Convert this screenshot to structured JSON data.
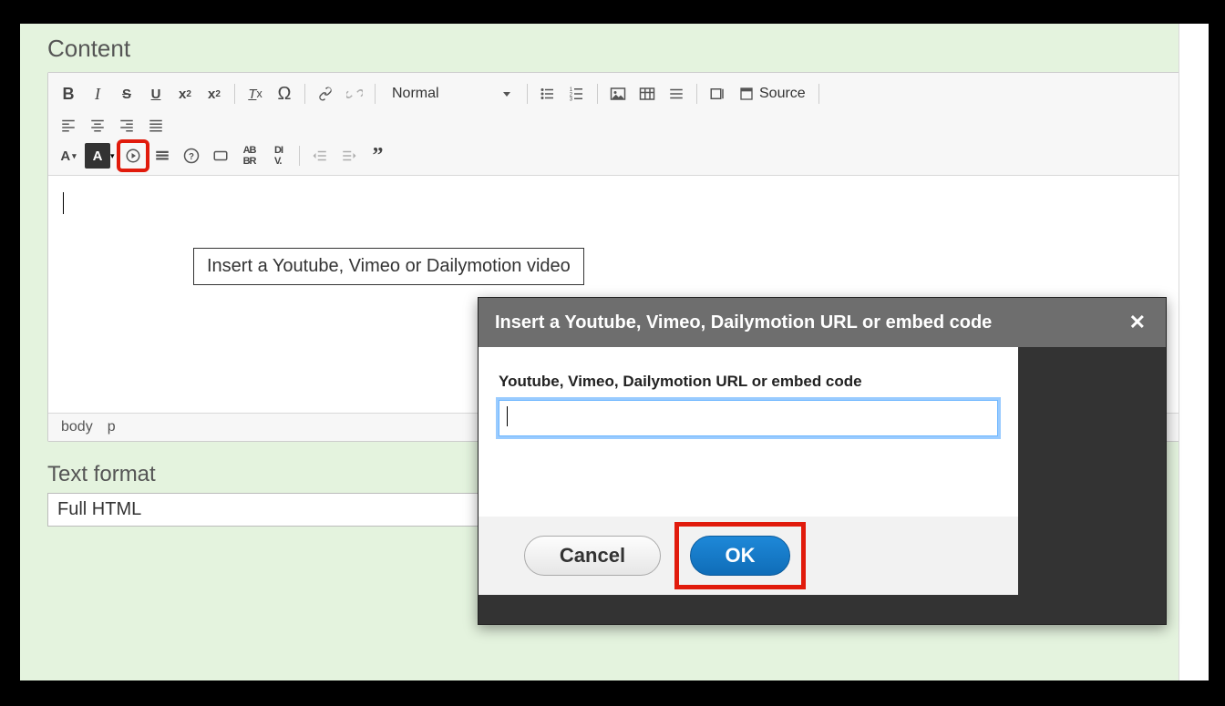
{
  "section": {
    "title": "Content"
  },
  "toolbar": {
    "format_label": "Normal",
    "source_label": "Source",
    "icons": {
      "bold": "B",
      "italic": "I",
      "strike": "S",
      "underline": "U",
      "sup": "x",
      "sub": "x",
      "txcolor_letter": "A",
      "bgcolor_letter": "A"
    }
  },
  "tooltip": {
    "text": "Insert a Youtube, Vimeo or Dailymotion video"
  },
  "statusbar": {
    "path": [
      "body",
      "p"
    ]
  },
  "text_format": {
    "label": "Text format",
    "value": "Full HTML"
  },
  "dialog": {
    "title": "Insert a Youtube, Vimeo, Dailymotion URL or embed code",
    "field_label": "Youtube, Vimeo, Dailymotion URL or embed code",
    "input_value": "",
    "cancel": "Cancel",
    "ok": "OK"
  }
}
